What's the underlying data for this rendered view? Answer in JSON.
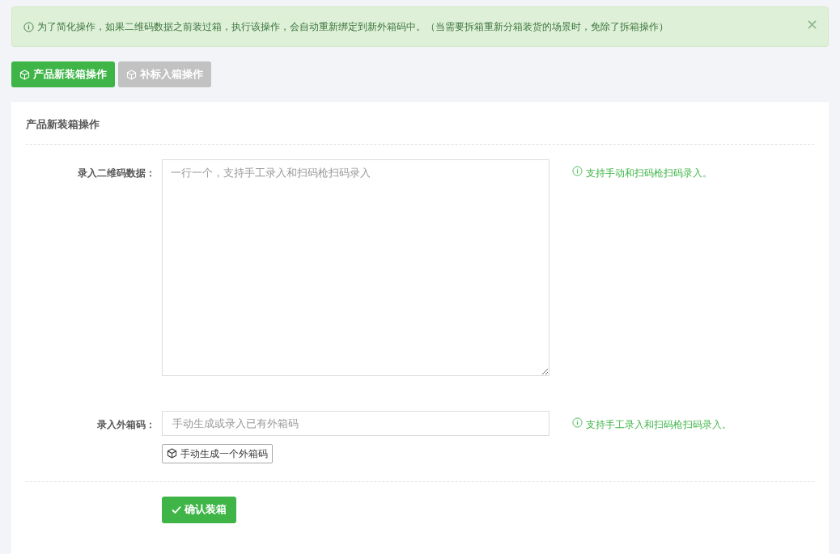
{
  "alert": {
    "text": "为了简化操作，如果二维码数据之前装过箱，执行该操作，会自动重新绑定到新外箱码中。（当需要拆箱重新分箱装货的场景时，免除了拆箱操作）",
    "close": "×"
  },
  "tabs": [
    {
      "label": "产品新装箱操作",
      "selected": true
    },
    {
      "label": "补标入箱操作",
      "selected": false
    }
  ],
  "card": {
    "title": "产品新装箱操作",
    "fields": [
      {
        "kind": "textarea",
        "label": "录入二维码数据：",
        "placeholder": "一行一个，支持手工录入和扫码枪扫码录入",
        "hint": "支持手动和扫码枪扫码录入。"
      },
      {
        "kind": "input",
        "label": "录入外箱码：",
        "placeholder": "手动生成或录入已有外箱码",
        "hint": "支持手工录入和扫码枪扫码录入。",
        "button": "手动生成一个外箱码"
      }
    ],
    "submit": "确认装箱"
  }
}
